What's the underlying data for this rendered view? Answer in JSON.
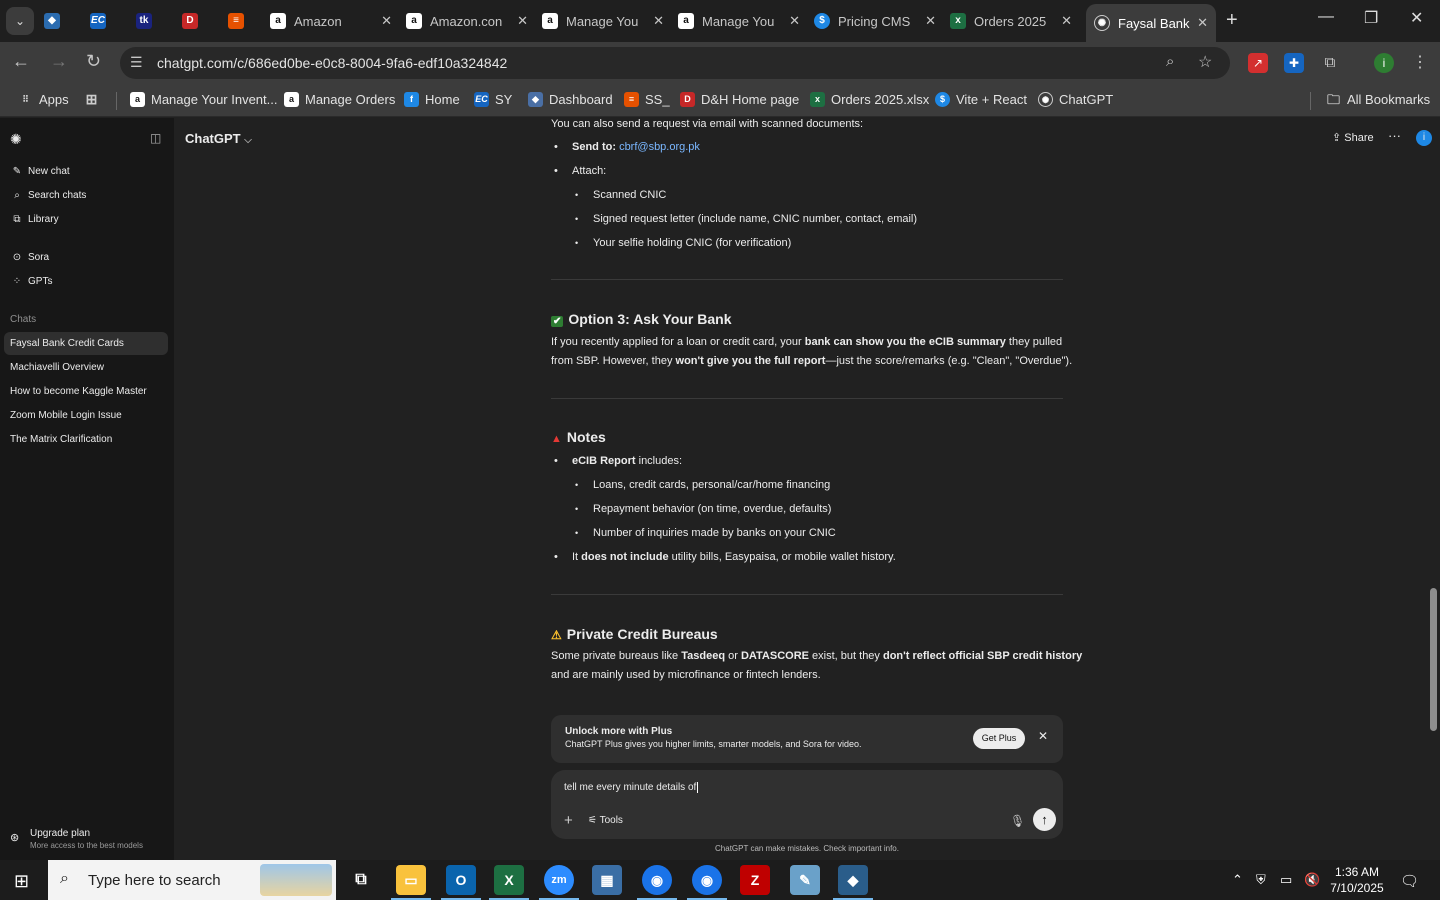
{
  "browser": {
    "tabs": [
      {
        "label": "",
        "favicon": "ext-blue"
      },
      {
        "label": "",
        "favicon": "EC"
      },
      {
        "label": "",
        "favicon": "tkc"
      },
      {
        "label": "",
        "favicon": "D&H"
      },
      {
        "label": "",
        "favicon": "stack"
      },
      {
        "label": "Amazon",
        "favicon": "amazon"
      },
      {
        "label": "Amazon.con",
        "favicon": "amazon"
      },
      {
        "label": "Manage You",
        "favicon": "amazon"
      },
      {
        "label": "Manage You",
        "favicon": "amazon"
      },
      {
        "label": "Pricing CMS",
        "favicon": "dollar"
      },
      {
        "label": "Orders 2025",
        "favicon": "excel"
      },
      {
        "label": "Faysal Bank",
        "favicon": "chatgpt",
        "active": true
      }
    ],
    "url": "chatgpt.com/c/686ed0be-e0c8-8004-9fa6-edf10a324842",
    "bookmarks": [
      {
        "label": "Apps"
      },
      {
        "label": "Manage Your Invent..."
      },
      {
        "label": "Manage Orders"
      },
      {
        "label": "Home"
      },
      {
        "label": "SY"
      },
      {
        "label": "Dashboard"
      },
      {
        "label": "SS_"
      },
      {
        "label": "D&H Home page"
      },
      {
        "label": "Orders 2025.xlsx"
      },
      {
        "label": "Vite + React"
      },
      {
        "label": "ChatGPT"
      }
    ],
    "all_bookmarks": "All Bookmarks"
  },
  "sidebar": {
    "actions": [
      {
        "label": "New chat",
        "icon": "edit-icon"
      },
      {
        "label": "Search chats",
        "icon": "search-icon"
      },
      {
        "label": "Library",
        "icon": "library-icon"
      }
    ],
    "extras": [
      {
        "label": "Sora",
        "icon": "play-icon"
      },
      {
        "label": "GPTs",
        "icon": "grid-icon"
      }
    ],
    "chats_heading": "Chats",
    "chats": [
      {
        "label": "Faysal Bank Credit Cards",
        "active": true
      },
      {
        "label": "Machiavelli Overview"
      },
      {
        "label": "How to become Kaggle Master"
      },
      {
        "label": "Zoom Mobile Login Issue"
      },
      {
        "label": "The Matrix Clarification"
      }
    ],
    "upgrade": {
      "title": "Upgrade plan",
      "subtitle": "More access to the best models"
    }
  },
  "header": {
    "model": "ChatGPT",
    "share": "Share"
  },
  "message": {
    "intro": "You can also send a request via email with scanned documents:",
    "send_to_label": "Send to:",
    "send_to_email": "cbrf@sbp.org.pk",
    "attach_label": "Attach:",
    "attach_items": [
      "Scanned CNIC",
      "Signed request letter (include name, CNIC number, contact, email)",
      "Your selfie holding CNIC (for verification)"
    ],
    "option3_title": "Option 3: Ask Your Bank",
    "option3_l1_a": "If you recently applied for a loan or credit card, your ",
    "option3_l1_b": "bank can show you the eCIB summary",
    "option3_l1_c": " they pulled",
    "option3_l2_a": "from SBP. However, they ",
    "option3_l2_b": "won't give you the full report",
    "option3_l2_c": "—just the score/remarks (e.g. \"Clean\", \"Overdue\").",
    "notes_title": "Notes",
    "notes_lead": "eCIB Report",
    "notes_lead_rest": " includes:",
    "notes_items": [
      "Loans, credit cards, personal/car/home financing",
      "Repayment behavior (on time, overdue, defaults)",
      "Number of inquiries made by banks on your CNIC"
    ],
    "notes_tail_a": "It ",
    "notes_tail_b": "does not include",
    "notes_tail_c": " utility bills, Easypaisa, or mobile wallet history.",
    "private_title": "Private Credit Bureaus",
    "private_l1_a": "Some private bureaus like ",
    "private_l1_b": "Tasdeeq",
    "private_l1_c": " or ",
    "private_l1_d": "DATASCORE",
    "private_l1_e": " exist, but they ",
    "private_l1_f": "don't reflect official SBP credit history",
    "private_l2": "and are mainly used by microfinance or fintech lenders."
  },
  "banner": {
    "title": "Unlock more with Plus",
    "desc": "ChatGPT Plus gives you higher limits, smarter models, and Sora for video.",
    "button": "Get Plus"
  },
  "composer": {
    "text": "tell me every minute details of",
    "tools": "Tools"
  },
  "disclaimer": "ChatGPT can make mistakes. Check important info.",
  "taskbar": {
    "search_placeholder": "Type here to search",
    "time": "1:36 AM",
    "date": "7/10/2025"
  }
}
